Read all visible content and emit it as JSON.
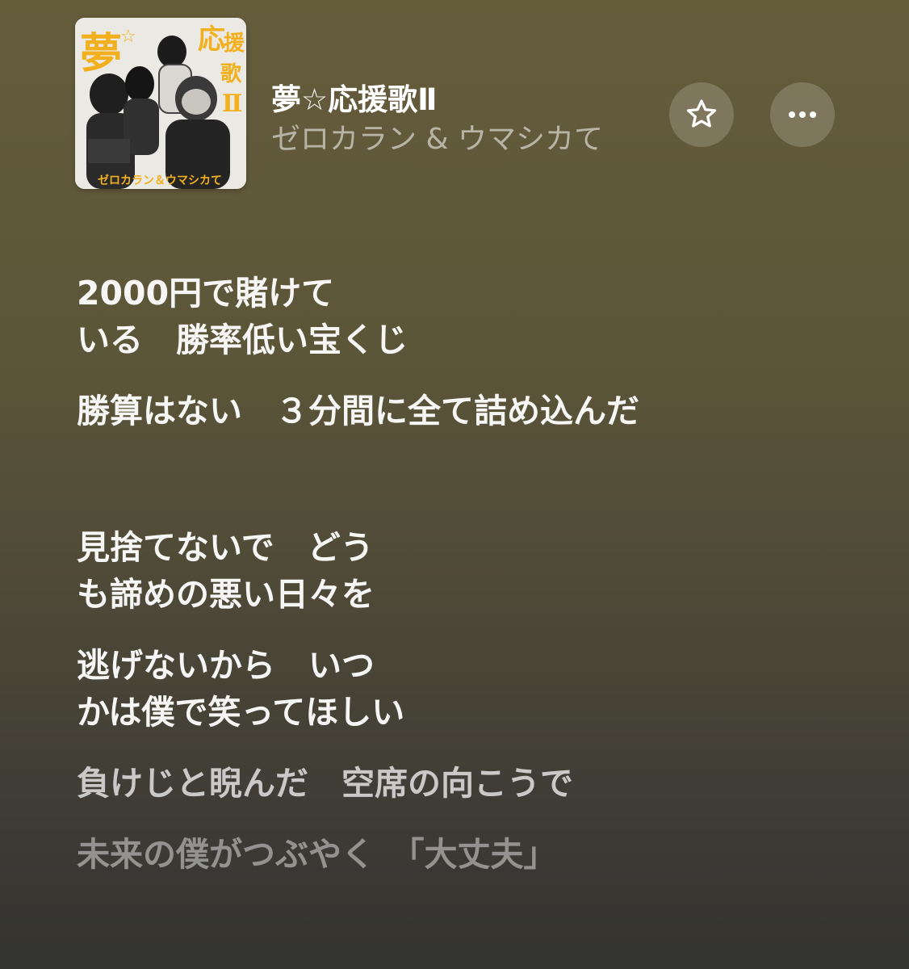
{
  "song": {
    "title": "夢☆応援歌Ⅱ",
    "artist": "ゼロカラン & ウマシカて"
  },
  "cover": {
    "title_text": "夢☆応援歌Ⅱ",
    "artist_text": "ゼロカラン & ウマシカて",
    "accent_color": "#f2b01e"
  },
  "buttons": {
    "favorite_icon": "star-icon",
    "more_icon": "ellipsis-icon"
  },
  "lyrics": [
    {
      "text": "2000円で賭けて",
      "state": "sung"
    },
    {
      "text": "いる　勝率低い宝くじ",
      "state": "sung"
    },
    {
      "text": "勝算はない　３分間に全て詰め込んだ",
      "state": "sung"
    },
    {
      "text": "見捨てないで　どう",
      "state": "sung"
    },
    {
      "text": "も諦めの悪い日々を",
      "state": "sung"
    },
    {
      "text": "逃げないから　いつ",
      "state": "sung"
    },
    {
      "text": "かは僕で笑ってほしい",
      "state": "sung"
    },
    {
      "text": "負けじと睨んだ　空席の向こうで",
      "state": "upcoming"
    },
    {
      "text": "未来の僕がつぶやく　「大丈夫」",
      "state": "upcoming"
    }
  ]
}
